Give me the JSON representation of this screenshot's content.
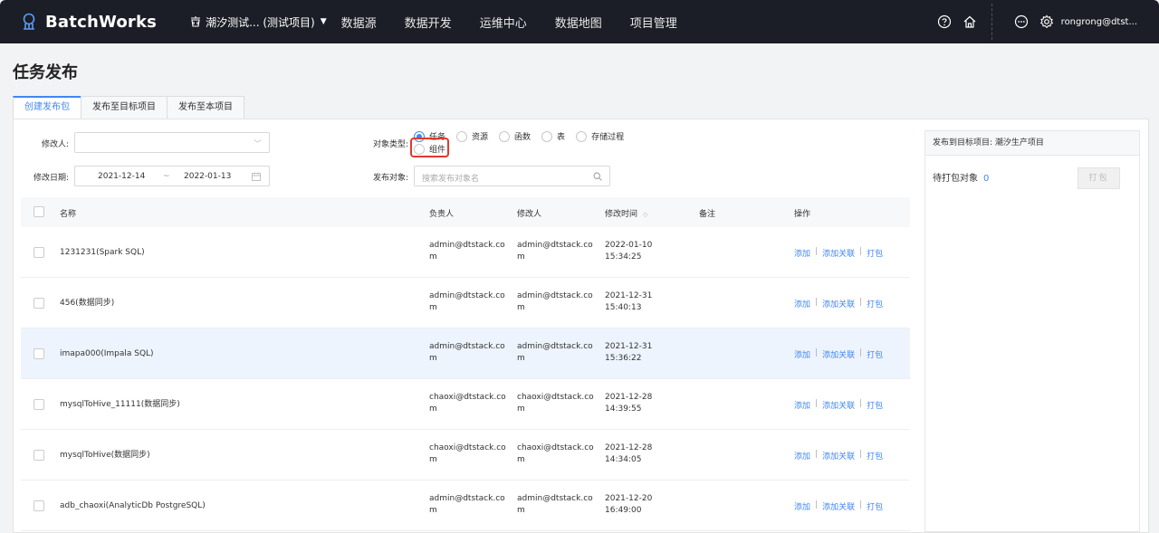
{
  "header": {
    "app_name": "BatchWorks",
    "project": "潮汐测试...   (测试项目)",
    "nav": [
      "数据源",
      "数据开发",
      "运维中心",
      "数据地图",
      "项目管理"
    ],
    "username": "rongrong@dtst..."
  },
  "page": {
    "title": "任务发布",
    "tabs": [
      "创建发布包",
      "发布至目标项目",
      "发布至本项目"
    ]
  },
  "filters": {
    "modifier_label": "修改人:",
    "date_label": "修改日期:",
    "date_start": "2021-12-14",
    "date_tilde": "~",
    "date_end": "2022-01-13",
    "type_label": "对象类型:",
    "types": [
      "任务",
      "资源",
      "函数",
      "表",
      "存储过程"
    ],
    "type_extra": "组件",
    "selected_type": "任务",
    "object_label": "发布对象:",
    "object_placeholder": "搜索发布对象名"
  },
  "table": {
    "headers": {
      "name": "名称",
      "owner": "负责人",
      "modifier": "修改人",
      "mtime": "修改时间",
      "note": "备注",
      "ops": "操作"
    },
    "op_add": "添加",
    "op_sep": "|",
    "op_add_rel": "添加关联",
    "op_pack": "打包",
    "rows": [
      {
        "name": "1231231(Spark SQL)",
        "owner1": "admin@dtstack.co",
        "owner2": "m",
        "mod1": "admin@dtstack.co",
        "mod2": "m",
        "date": "2022-01-10",
        "time": "15:34:25"
      },
      {
        "name": "456(数据同步)",
        "owner1": "admin@dtstack.co",
        "owner2": "m",
        "mod1": "admin@dtstack.co",
        "mod2": "m",
        "date": "2021-12-31",
        "time": "15:40:13"
      },
      {
        "name": "imapa000(Impala SQL)",
        "owner1": "admin@dtstack.co",
        "owner2": "m",
        "mod1": "admin@dtstack.co",
        "mod2": "m",
        "date": "2021-12-31",
        "time": "15:36:22"
      },
      {
        "name": "mysqlToHive_11111(数据同步)",
        "owner1": "chaoxi@dtstack.co",
        "owner2": "m",
        "mod1": "chaoxi@dtstack.co",
        "mod2": "m",
        "date": "2021-12-28",
        "time": "14:39:55"
      },
      {
        "name": "mysqlToHive(数据同步)",
        "owner1": "chaoxi@dtstack.co",
        "owner2": "m",
        "mod1": "chaoxi@dtstack.co",
        "mod2": "m",
        "date": "2021-12-28",
        "time": "14:34:05"
      },
      {
        "name": "adb_chaoxi(AnalyticDb PostgreSQL)",
        "owner1": "admin@dtstack.co",
        "owner2": "m",
        "mod1": "admin@dtstack.co",
        "mod2": "m",
        "date": "2021-12-20",
        "time": "16:49:00"
      }
    ]
  },
  "panel": {
    "head": "发布到目标项目: 潮汐生产项目",
    "pending_label": "待打包对象",
    "pending_count": "0",
    "pack_button": "打包"
  },
  "colors": {
    "accent": "#3f87f5",
    "nav_bg": "#1b1e26",
    "highlight": "#e03a2c"
  }
}
